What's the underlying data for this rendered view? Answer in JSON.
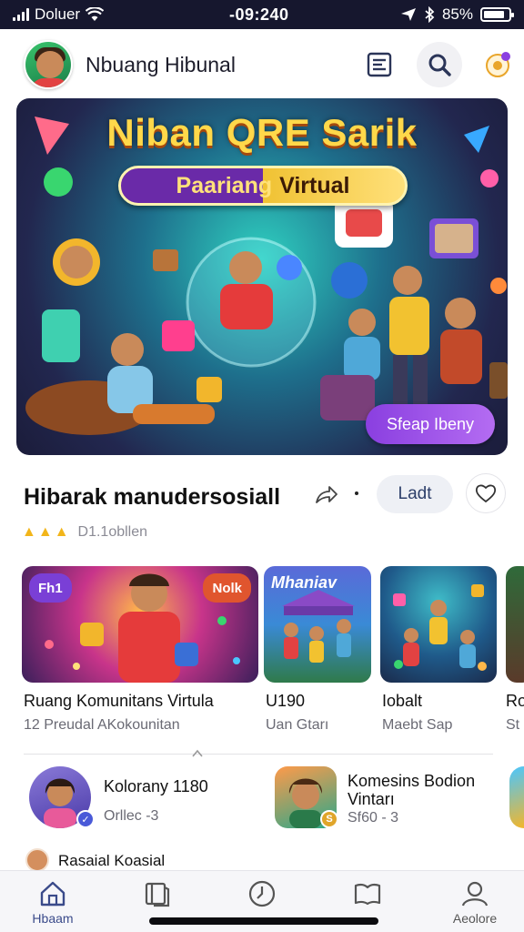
{
  "status_bar": {
    "carrier": "Doluer",
    "time": "-09:240",
    "battery_percent": "85%",
    "battery_level": 0.85
  },
  "header": {
    "title": "Nbuang Hibunal",
    "icons": [
      "profile-avatar",
      "list-icon",
      "search-icon",
      "notification-icon"
    ]
  },
  "hero": {
    "title": "Niban QRE Sarik",
    "subtitle_left": "Paariang",
    "subtitle_right": "Virtual",
    "cta_label": "Sfeap Ibeny"
  },
  "detail": {
    "title": "Hibarak manudersosiall",
    "action_label": "Ladt",
    "rating_text": "D1.1obllen",
    "rating_thumbs": 3
  },
  "cards": [
    {
      "badge_left": "Fh1",
      "badge_right": "Nolk",
      "title": "Ruang Komunitans Virtula",
      "subtitle": "12 Preudal AKokounitan"
    },
    {
      "overlay": "Mhaniav",
      "title": "U190",
      "subtitle": "Uan Gtarı"
    },
    {
      "title": "Iobalt",
      "subtitle": "Maebt Sap"
    },
    {
      "title": "Ro",
      "subtitle": "St"
    }
  ],
  "communities": [
    {
      "name": "Kolorany 1180",
      "sub": "Orllec -3",
      "badge": "✓"
    },
    {
      "name": "Komesins Bodion Vintarı",
      "sub": "Sf60 - 3",
      "badge": "S"
    }
  ],
  "next_section": {
    "title": "Rasaial Koasial"
  },
  "nav": [
    {
      "label": "Hbaam",
      "icon": "home-icon",
      "active": true
    },
    {
      "label": "",
      "icon": "book-open-icon",
      "active": false
    },
    {
      "label": "",
      "icon": "clock-icon",
      "active": false
    },
    {
      "label": "",
      "icon": "reader-icon",
      "active": false
    },
    {
      "label": "Aeolore",
      "icon": "profile-icon",
      "active": false
    }
  ],
  "colors": {
    "accent_purple": "#8a3fe0",
    "status_bar_bg": "#16172e",
    "hero_title": "#ffd84a"
  }
}
